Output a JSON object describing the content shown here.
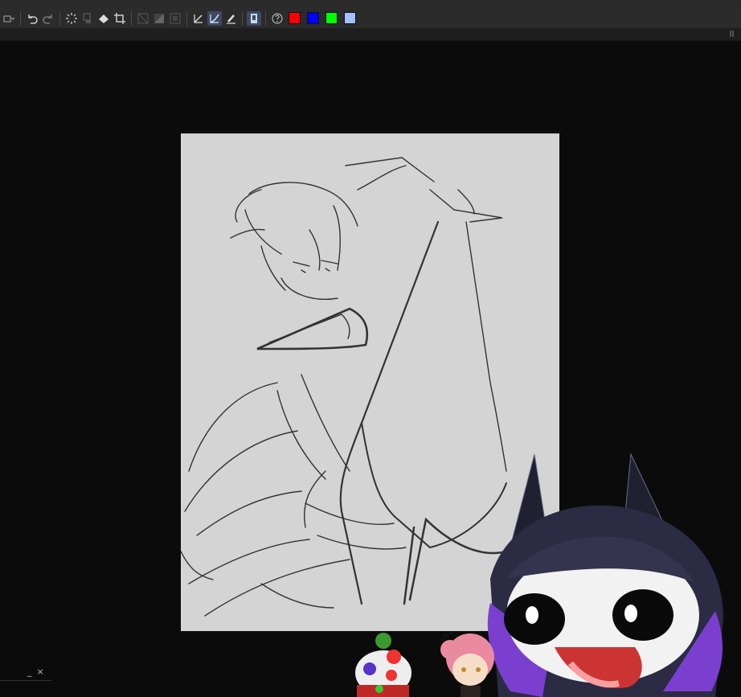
{
  "toolbar": {
    "buttons": [
      {
        "name": "layer-mode-icon",
        "active": false
      },
      {
        "name": "undo-icon",
        "active": false
      },
      {
        "name": "redo-icon",
        "active": false
      },
      {
        "name": "loading-spinner-icon",
        "active": false
      },
      {
        "name": "stamp-icon",
        "active": false
      },
      {
        "name": "fill-bucket-icon",
        "active": false
      },
      {
        "name": "crop-icon",
        "active": false
      },
      {
        "name": "transform-icon",
        "active": false
      },
      {
        "name": "gradient-icon",
        "active": false
      },
      {
        "name": "frame-icon",
        "active": false
      },
      {
        "name": "pen-tool-icon",
        "active": false
      },
      {
        "name": "brush-tool-icon",
        "active": true
      },
      {
        "name": "eraser-tool-icon",
        "active": false
      },
      {
        "name": "document-icon",
        "active": true
      },
      {
        "name": "help-icon",
        "active": false
      }
    ],
    "colors": [
      "#ff0000",
      "#0000ff",
      "#00ff00",
      "#a0c0ff"
    ]
  },
  "panel": {
    "minimize_label": "_",
    "close_label": "×"
  }
}
